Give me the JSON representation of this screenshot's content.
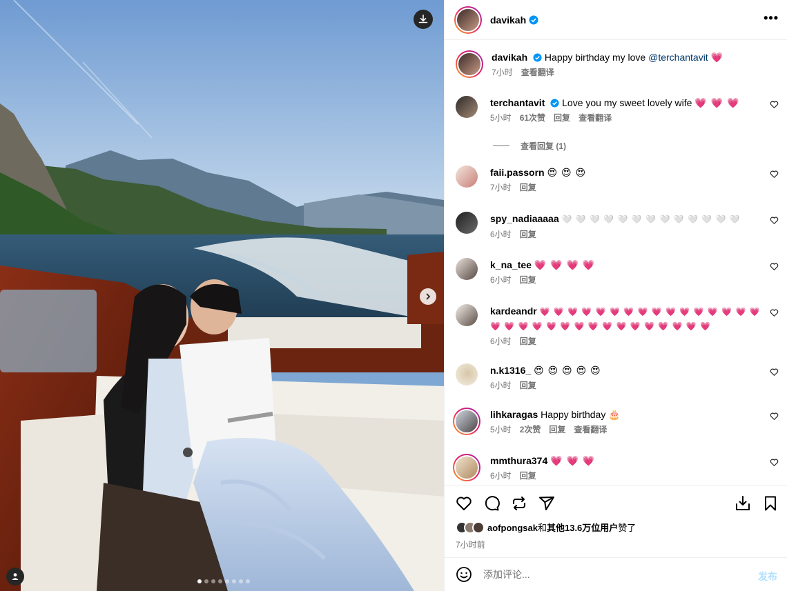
{
  "post": {
    "author": "davikah",
    "more_label": "•••"
  },
  "photo": {
    "slide_count": 8,
    "active_slide": 1
  },
  "caption": {
    "user": "davikah",
    "text": "Happy birthday my love",
    "mention": "@terchantavit",
    "emoji": "💗",
    "time": "7小时",
    "translate": "查看翻译"
  },
  "comments": [
    {
      "user": "terchantavit",
      "verified": true,
      "text": "Love you my sweet lovely wife",
      "emoji": "💗 💗 💗",
      "time": "5小时",
      "likes": "61次赞",
      "reply": "回复",
      "translate": "查看翻译"
    },
    {
      "user": "faii.passorn",
      "verified": false,
      "text": "",
      "emoji": "😍 😍 😍",
      "time": "7小时",
      "reply": "回复"
    },
    {
      "user": "spy_nadiaaaaa",
      "verified": false,
      "text": "",
      "emoji": "🤍 🤍 🤍 🤍 🤍 🤍 🤍 🤍 🤍 🤍 🤍 🤍 🤍",
      "time": "6小时",
      "reply": "回复"
    },
    {
      "user": "k_na_tee",
      "verified": false,
      "text": "",
      "emoji": "💗 💗 💗 💗",
      "time": "6小时",
      "reply": "回复"
    },
    {
      "user": "kardeandr",
      "verified": false,
      "text": "",
      "emoji": "💗 💗 💗 💗 💗 💗 💗 💗 💗 💗 💗 💗 💗 💗 💗 💗",
      "emoji2": "💗 💗 💗 💗 💗 💗 💗 💗 💗 💗 💗 💗 💗 💗 💗 💗",
      "time": "6小时",
      "reply": "回复"
    },
    {
      "user": "n.k1316_",
      "verified": false,
      "text": "",
      "emoji": "😍 😍 😍 😍 😍",
      "time": "6小时",
      "reply": "回复"
    },
    {
      "user": "lihkaragas",
      "verified": false,
      "text": "Happy birthday",
      "emoji": "🎂",
      "time": "5小时",
      "likes": "2次赞",
      "reply": "回复",
      "translate": "查看翻译"
    },
    {
      "user": "mmthura374",
      "verified": false,
      "text": "",
      "emoji": "💗 💗 💗",
      "time": "6小时",
      "reply": "回复"
    }
  ],
  "view_replies": "查看回复 (1)",
  "likes_line": {
    "user": "aofpongsak",
    "connector": "和",
    "others": "其他13.6万位用户",
    "suffix": "赞了"
  },
  "post_time": "7小时前",
  "composer": {
    "placeholder": "添加评论...",
    "post_label": "发布"
  },
  "colors": {
    "verified": "#0095f6",
    "link": "#00376b",
    "muted": "#737373",
    "post_disabled": "#b2dffc"
  }
}
